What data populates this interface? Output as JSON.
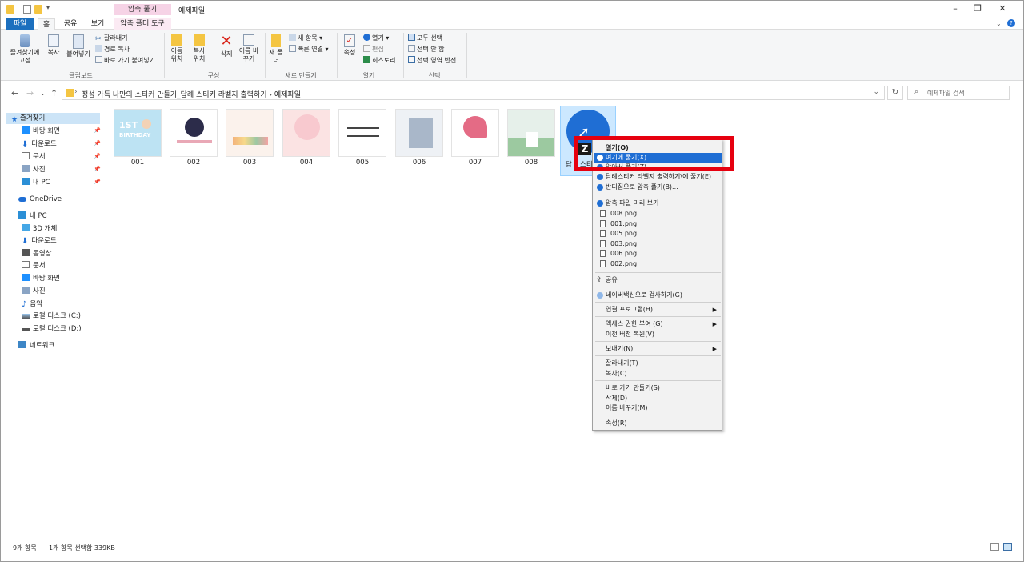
{
  "window": {
    "title": "예제파일",
    "context_tab_header": "압축 풀기"
  },
  "ribbon": {
    "tabs": [
      "파일",
      "홈",
      "공유",
      "보기",
      "압축 폴더 도구"
    ],
    "clipboard": {
      "pin_label": "즐겨찾기에 고정",
      "copy_label": "복사",
      "paste_label": "붙여넣기",
      "cut_label": "잘라내기",
      "copy_path_label": "경로 복사",
      "paste_shortcut_label": "바로 가기 붙여넣기",
      "group_label": "클립보드"
    },
    "organize": {
      "move_label": "이동 위치",
      "copy_to_label": "복사 위치",
      "delete_label": "삭제",
      "rename_label": "이름 바꾸기",
      "group_label": "구성"
    },
    "new": {
      "new_folder_label": "새 폴더",
      "new_item_label": "새 항목",
      "easy_access_label": "빠른 연결",
      "group_label": "새로 만들기"
    },
    "open": {
      "properties_label": "속성",
      "open_label": "열기",
      "edit_label": "편집",
      "history_label": "히스토리",
      "group_label": "열기"
    },
    "select": {
      "select_all_label": "모두 선택",
      "select_none_label": "선택 안 함",
      "invert_label": "선택 영역 반전",
      "group_label": "선택"
    }
  },
  "address": {
    "path": "정성 가득 나만의 스티커 만들기_답례 스티커 라벨지 출력하기  ›  예제파일",
    "search_placeholder": "예제파일 검색"
  },
  "nav": {
    "quick_access": "즐겨찾기",
    "quick_items": [
      "바탕 화면",
      "다운로드",
      "문서",
      "사진",
      "내 PC"
    ],
    "onedrive": "OneDrive",
    "this_pc": "내 PC",
    "pc_items": [
      "3D 개체",
      "다운로드",
      "동영상",
      "문서",
      "바탕 화면",
      "사진",
      "음악",
      "로컬 디스크 (C:)",
      "로컬 디스크 (D:)"
    ],
    "network": "네트워크"
  },
  "files": [
    "001",
    "002",
    "003",
    "004",
    "005",
    "006",
    "007",
    "008"
  ],
  "zip_file_label_partial": "답",
  "zip_file_label_partial2": "스티",
  "context_menu": {
    "open": "열기(O)",
    "extract_here": "여기에 풀기(X)",
    "extract_to_partial": "알아서 풀기(Z)",
    "extract_folder_partial": "답례스티커 라벨지 출력하기\\에 풀기(E)",
    "bandizip_extract": "반디집으로 압축 풀기(B)...",
    "preview": "압축 파일 미리 보기",
    "preview_files": [
      "008.png",
      "001.png",
      "005.png",
      "003.png",
      "006.png",
      "002.png"
    ],
    "share": "공유",
    "naver_vaccine": "네이버백신으로 검사하기(G)",
    "open_with": "연결 프로그램(H)",
    "give_access": "액세스 권한 부여 (G)",
    "restore_versions": "이전 버전 복원(V)",
    "send_to": "보내기(N)",
    "cut": "잘라내기(T)",
    "copy": "복사(C)",
    "create_shortcut": "바로 가기 만들기(S)",
    "delete": "삭제(D)",
    "rename": "이름 바꾸기(M)",
    "properties": "속성(R)"
  },
  "status": {
    "item_count": "9개 항목",
    "selection": "1개 항목 선택함 339KB"
  },
  "colors": {
    "accent": "#1f6ed4",
    "highlight_box": "#e6000f",
    "selection_bg": "#cce8ff"
  }
}
